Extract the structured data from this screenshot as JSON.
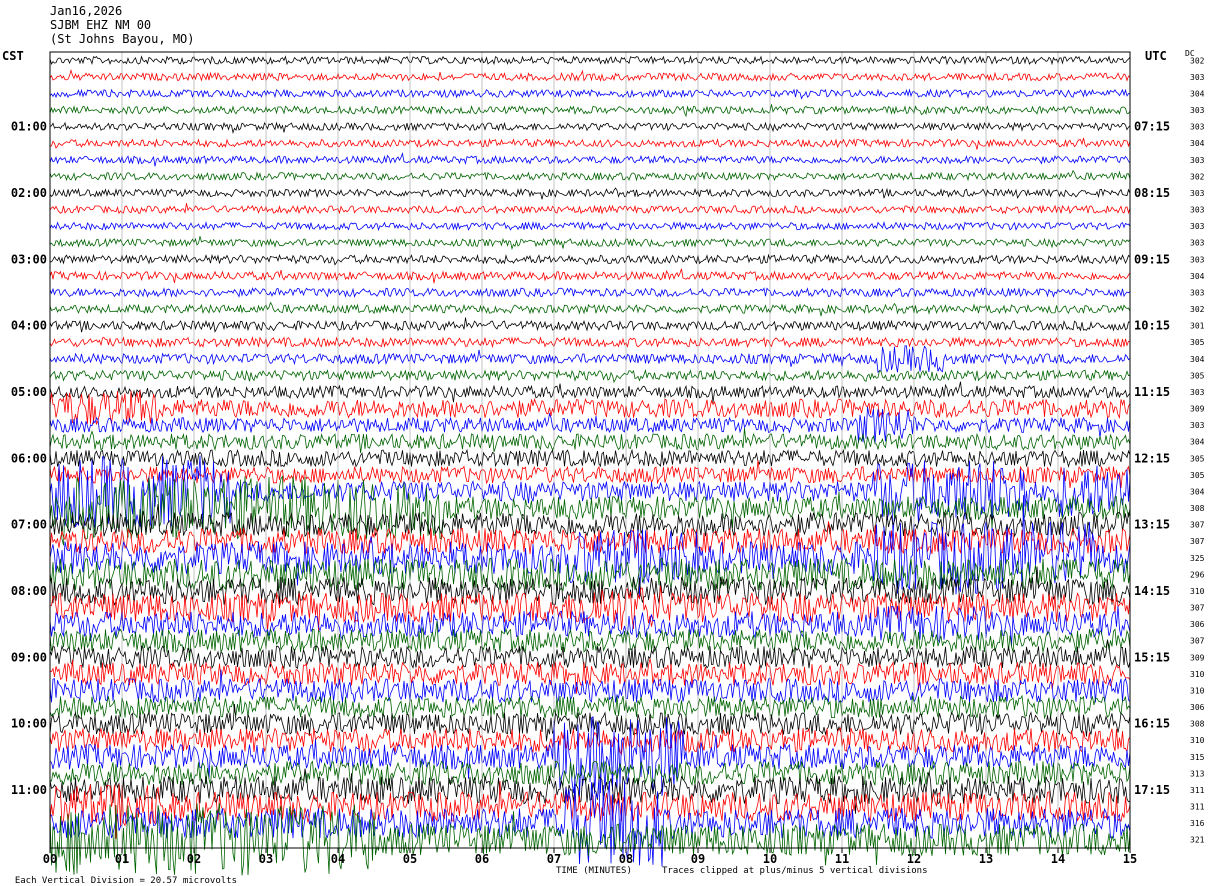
{
  "header": {
    "date": "Jan16,2026",
    "station": "SJBM EHZ NM 00",
    "location": "(St Johns Bayou, MO)"
  },
  "labels": {
    "left_timezone": "CST",
    "right_timezone": "UTC",
    "dc_header": "DC"
  },
  "footer": {
    "scale_note": "Each Vertical Division = 20.57 microvolts",
    "time_note": "TIME (MINUTES)",
    "clip_note": "Traces clipped at plus/minus 5 vertical divisions"
  },
  "colors": {
    "trace_cycle": [
      "#000000",
      "#ff0000",
      "#0000ff",
      "#006400"
    ],
    "grid": "#9a9a9a",
    "axis": "#000000"
  },
  "chart_data": {
    "type": "helicorder",
    "x_axis": {
      "range": [
        0,
        15
      ],
      "ticks": [
        "00",
        "01",
        "02",
        "03",
        "04",
        "05",
        "06",
        "07",
        "08",
        "09",
        "10",
        "11",
        "12",
        "13",
        "14",
        "15"
      ]
    },
    "rows_per_hour": 4,
    "row_minutes": 15,
    "left_hour_labels": [
      "01:00",
      "02:00",
      "03:00",
      "04:00",
      "05:00",
      "06:00",
      "07:00",
      "08:00",
      "09:00",
      "10:00",
      "11:00"
    ],
    "right_hour_labels": [
      "07:15",
      "08:15",
      "09:15",
      "10:15",
      "11:15",
      "12:15",
      "13:15",
      "14:15",
      "15:15",
      "16:15",
      "17:15"
    ],
    "dc_offsets": [
      302,
      303,
      304,
      303,
      303,
      304,
      303,
      302,
      303,
      303,
      303,
      303,
      303,
      304,
      303,
      302,
      301,
      305,
      304,
      305,
      303,
      309,
      303,
      304,
      305,
      305,
      304,
      308,
      307,
      307,
      325,
      296,
      310,
      307,
      306,
      307,
      309,
      310,
      310,
      306,
      308,
      310,
      315,
      313,
      311,
      311,
      316,
      321
    ],
    "row_amplitude": [
      0.8,
      0.8,
      0.8,
      0.8,
      0.8,
      0.8,
      0.8,
      0.8,
      0.8,
      0.8,
      0.8,
      0.8,
      0.9,
      0.9,
      0.9,
      0.9,
      1.0,
      1.0,
      1.1,
      1.1,
      1.3,
      2.0,
      1.6,
      1.7,
      1.8,
      1.8,
      2.2,
      2.5,
      2.6,
      2.8,
      3.5,
      3.5,
      3.0,
      3.2,
      2.8,
      2.5,
      2.4,
      2.5,
      2.6,
      2.4,
      2.4,
      2.6,
      2.7,
      2.6,
      3.0,
      3.2,
      3.3,
      3.5
    ],
    "bursts": [
      {
        "row": 21,
        "start": 0.0,
        "end": 1.5,
        "amp": 2.0
      },
      {
        "row": 22,
        "start": 11.2,
        "end": 12.0,
        "amp": 2.0
      },
      {
        "row": 18,
        "start": 11.5,
        "end": 12.5,
        "amp": 1.5
      },
      {
        "row": 26,
        "start": 0.0,
        "end": 2.5,
        "amp": 4.0
      },
      {
        "row": 26,
        "start": 11.4,
        "end": 13.6,
        "amp": 3.5
      },
      {
        "row": 26,
        "start": 14.0,
        "end": 15.0,
        "amp": 3.0
      },
      {
        "row": 27,
        "start": 0.0,
        "end": 5.5,
        "amp": 3.5
      },
      {
        "row": 30,
        "start": 7.2,
        "end": 9.0,
        "amp": 3.2
      },
      {
        "row": 30,
        "start": 11.4,
        "end": 14.5,
        "amp": 4.0
      },
      {
        "row": 33,
        "start": 7.3,
        "end": 8.5,
        "amp": 2.5
      },
      {
        "row": 34,
        "start": 11.5,
        "end": 13.0,
        "amp": 2.0
      },
      {
        "row": 42,
        "start": 7.0,
        "end": 8.8,
        "amp": 4.5
      },
      {
        "row": 45,
        "start": 0.0,
        "end": 1.5,
        "amp": 2.5
      },
      {
        "row": 46,
        "start": 7.0,
        "end": 8.5,
        "amp": 5.0
      },
      {
        "row": 47,
        "start": 0.0,
        "end": 4.5,
        "amp": 4.0
      }
    ]
  }
}
